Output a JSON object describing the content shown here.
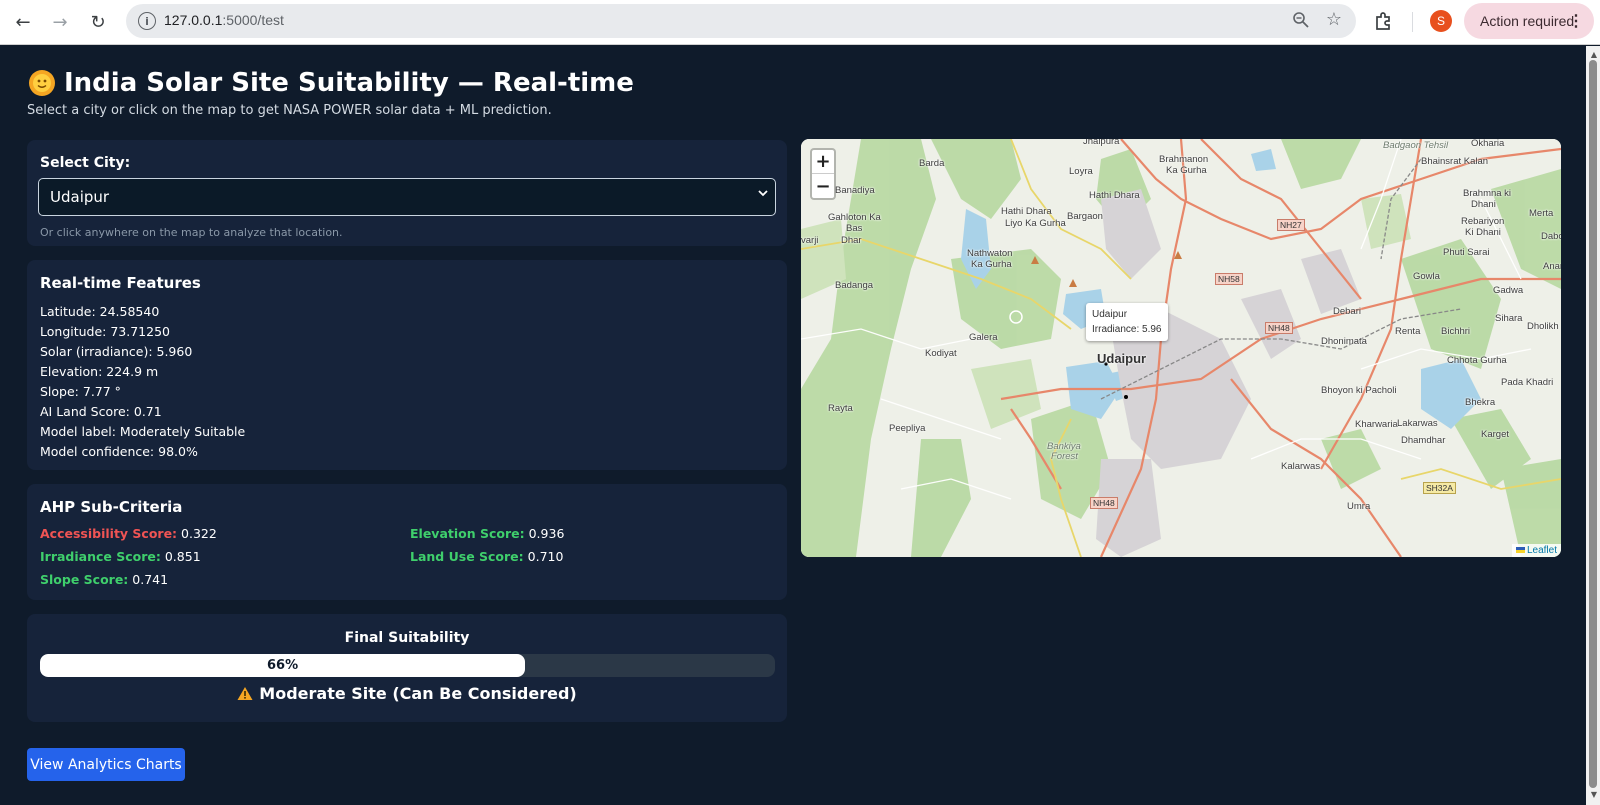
{
  "browser": {
    "url_host": "127.0.0.1",
    "url_path": ":5000/test",
    "profile_initial": "S",
    "action_required": "Action required"
  },
  "page": {
    "title": "India Solar Site Suitability — Real-time",
    "subtitle": "Select a city or click on the map to get NASA POWER solar data + ML prediction."
  },
  "city": {
    "label": "Select City:",
    "selected": "Udaipur",
    "hint": "Or click anywhere on the map to analyze that location."
  },
  "features": {
    "heading": "Real-time Features",
    "items": [
      "Latitude: 24.58540",
      "Longitude: 73.71250",
      "Solar (irradiance): 5.960",
      "Elevation: 224.9 m",
      "Slope: 7.77 °",
      "AI Land Score: 0.71",
      "Model label: Moderately Suitable",
      "Model confidence: 98.0%"
    ]
  },
  "ahp": {
    "heading": "AHP Sub-Criteria",
    "accessibility": {
      "label": "Accessibility Score:",
      "value": "0.322",
      "color": "#f05454"
    },
    "elevation": {
      "label": "Elevation Score:",
      "value": "0.936",
      "color": "#3fcf6c"
    },
    "irradiance": {
      "label": "Irradiance Score:",
      "value": "0.851",
      "color": "#3fcf6c"
    },
    "landuse": {
      "label": "Land Use Score:",
      "value": "0.710",
      "color": "#3fcf6c"
    },
    "slope": {
      "label": "Slope Score:",
      "value": "0.741",
      "color": "#3fcf6c"
    }
  },
  "final": {
    "heading": "Final Suitability",
    "percent_label": "66%",
    "percent": 66,
    "verdict": "Moderate Site (Can Be Considered)"
  },
  "analytics_button": "View Analytics Charts",
  "map": {
    "zoom_in": "+",
    "zoom_out": "−",
    "tooltip_city": "Udaipur",
    "tooltip_irradiance": "Irradiance: 5.96",
    "attribution": "Leaflet",
    "labels": {
      "jhalpura": "Jhalpura",
      "brahmanon": "Brahmanon",
      "kagurha": "Ka Gurha",
      "badgaon_tehsil": "Badgaon Tehsil",
      "okharia": "Okharia",
      "bhainsrat": "Bhainsrat Kalan",
      "barda": "Barda",
      "loyra": "Loyra",
      "hathidhara1": "Hathi Dhara",
      "banadiya": "Banadiya",
      "brahmna": "Brahmna ki",
      "dhani1": "Dhani",
      "gahloton": "Gahloton Ka",
      "bas": "Bas",
      "dhar": "Dhar",
      "hathidhara2": "Hathi Dhara",
      "bargaon": "Bargaon",
      "liyo": "Liyo Ka Gurha",
      "merta": "Merta",
      "rebariyon": "Rebariyon",
      "kidhani": "Ki Dhani",
      "varji": "varji",
      "dabo": "Dabo",
      "nathwaton": "Nathwaton",
      "kagurha2": "Ka Gurha",
      "phuti": "Phuti Sarai",
      "anand": "Anand",
      "gowla": "Gowla",
      "badanga": "Badanga",
      "gadwa": "Gadwa",
      "debari": "Debari",
      "sihara": "Sihara",
      "galera": "Galera",
      "renta": "Renta",
      "bichhri": "Bichhri",
      "dholikh": "Dholikh",
      "dhonimata": "Dhonimata",
      "kodiyat": "Kodiyat",
      "udaipur": "Udaipur",
      "chhota": "Chhota Gurha",
      "pada": "Pada Khadri",
      "bhoyon": "Bhoyon ki Pacholi",
      "bhekra": "Bhekra",
      "rayta": "Rayta",
      "kharwaria": "Kharwaria",
      "lakarwas": "Lakarwas",
      "peepliya": "Peepliya",
      "dhamdhar": "Dhamdhar",
      "karget": "Karget",
      "bankiya": "Bankiya",
      "forest": "Forest",
      "kalarwas": "Kalarwas",
      "umra": "Umra",
      "nh27": "NH27",
      "nh58": "NH58",
      "nh48a": "NH48",
      "nh48b": "NH48",
      "sh32a": "SH32A"
    }
  }
}
